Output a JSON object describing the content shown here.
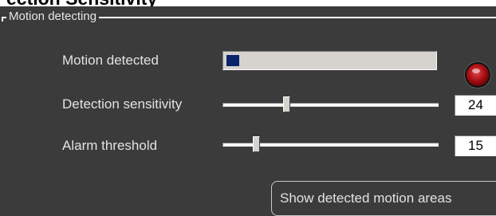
{
  "header": {
    "clipped_title": "ection Sensitivity"
  },
  "group": {
    "title": "Motion detecting"
  },
  "rows": {
    "motion_detected": {
      "label": "Motion detected",
      "level": 0.06
    },
    "detection_sensitivity": {
      "label": "Detection sensitivity",
      "value": "24"
    },
    "alarm_threshold": {
      "label": "Alarm threshold",
      "value": "15"
    }
  },
  "buttons": {
    "show_motion_areas": "Show detected motion areas"
  },
  "colors": {
    "background": "#3b3b3b",
    "progress_fill": "#0a246a",
    "indicator": "#a80f14"
  },
  "icons": {
    "indicator": "red-led-icon"
  }
}
